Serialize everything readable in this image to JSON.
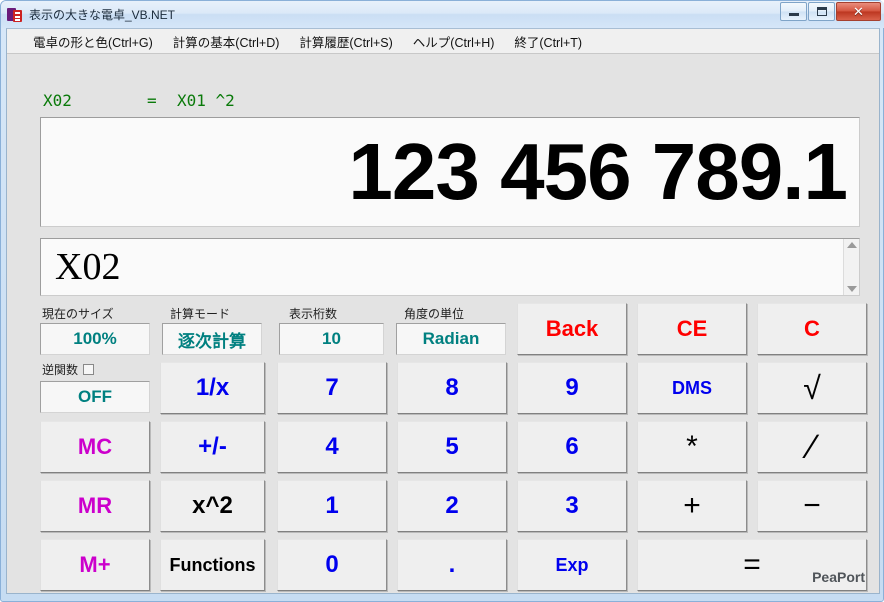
{
  "window": {
    "title": "表示の大きな電卓_VB.NET",
    "icon": "app-logo-icon",
    "minimize_label": "–",
    "maximize_label": "□",
    "close_label": "✕"
  },
  "menubar": {
    "items": [
      {
        "label": "電卓の形と色(Ctrl+G)"
      },
      {
        "label": "計算の基本(Ctrl+D)"
      },
      {
        "label": "計算履歴(Ctrl+S)"
      },
      {
        "label": "ヘルプ(Ctrl+H)"
      },
      {
        "label": "終了(Ctrl+T)"
      }
    ]
  },
  "formula": {
    "lhs": "X02",
    "equals": "=",
    "rhs": "X01 ^2",
    "color": "#0a7a0a"
  },
  "display": {
    "value": "123 456 789.1"
  },
  "expression": {
    "value": "X02",
    "placeholder": ""
  },
  "status": {
    "size": {
      "label": "現在のサイズ",
      "value": "100%"
    },
    "mode": {
      "label": "計算モード",
      "value": "逐次計算"
    },
    "digits": {
      "label": "表示桁数",
      "value": "10"
    },
    "angle": {
      "label": "角度の単位",
      "value": "Radian"
    },
    "inverse": {
      "label": "逆関数",
      "checked": false,
      "value": "OFF"
    },
    "accent_color": "#008080"
  },
  "keys": {
    "back": "Back",
    "ce": "CE",
    "c": "C",
    "recip": "1/x",
    "d7": "7",
    "d8": "8",
    "d9": "9",
    "dms": "DMS",
    "sqrt": "√",
    "mc": "MC",
    "plusminus": "+/-",
    "d4": "4",
    "d5": "5",
    "d6": "6",
    "multiply": "*",
    "divide": "∕",
    "mr": "MR",
    "square": "x^2",
    "d1": "1",
    "d2": "2",
    "d3": "3",
    "plus": "+",
    "minus": "−",
    "mplus": "M+",
    "functions": "Functions",
    "d0": "0",
    "dot": ".",
    "exp": "Exp",
    "equals": "="
  },
  "footer": {
    "brand": "PeaPort"
  }
}
